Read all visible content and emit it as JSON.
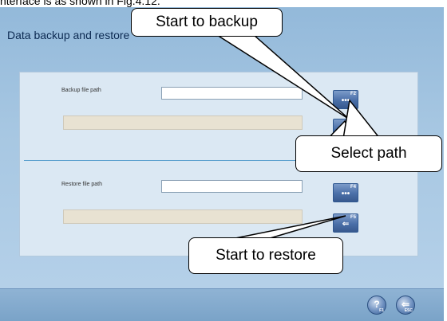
{
  "document": {
    "caption_fragment": "nterface is as shown in Fig.4.12."
  },
  "window": {
    "title": "Data backup and restore"
  },
  "backup": {
    "label": "Backup file path",
    "path_value": "",
    "browse_glyph": "•••",
    "browse_key": "F2",
    "start_glyph": "⇐",
    "start_key": "F3"
  },
  "restore": {
    "label": "Restore file path",
    "path_value": "",
    "browse_glyph": "•••",
    "browse_key": "F4",
    "start_glyph": "⇐",
    "start_key": "F5"
  },
  "footer": {
    "help_glyph": "?",
    "help_key": "F1",
    "exit_glyph": "⇐",
    "exit_key": "ESC"
  },
  "callouts": {
    "start_backup": "Start to backup",
    "select_path": "Select path",
    "start_restore": "Start to restore"
  },
  "icons": {
    "help": "question-mark-icon",
    "exit": "back-arrow-icon",
    "browse": "ellipsis-icon",
    "start": "arrow-icon"
  }
}
